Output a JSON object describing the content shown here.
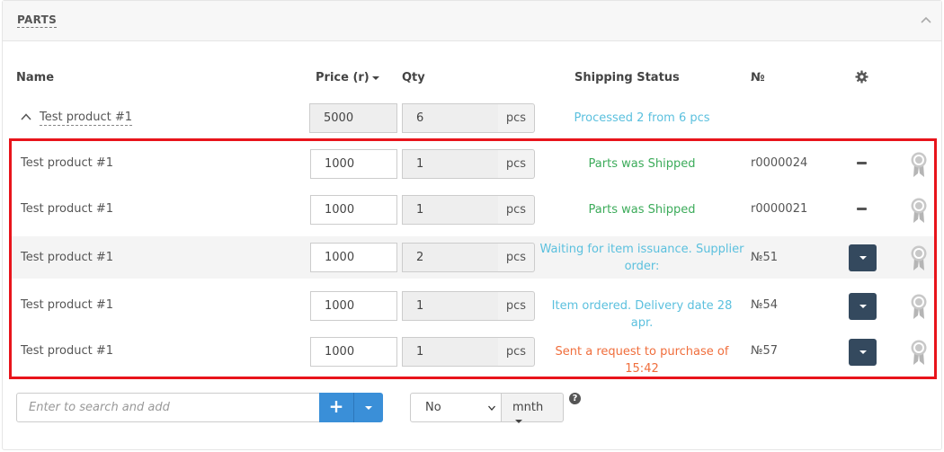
{
  "panel": {
    "title": "PARTS"
  },
  "columns": {
    "name": "Name",
    "price": "Price (r)",
    "qty": "Qty",
    "shipping_status": "Shipping Status",
    "number": "№"
  },
  "main_product": {
    "name": "Test product #1",
    "price": "5000",
    "qty": "6",
    "unit": "pcs",
    "status": "Processed 2 from 6 pcs"
  },
  "rows": [
    {
      "name": "Test product #1",
      "price": "1000",
      "qty": "1",
      "unit": "pcs",
      "status": "Parts was Shipped",
      "number": "r0000024",
      "action": "minus"
    },
    {
      "name": "Test product #1",
      "price": "1000",
      "qty": "1",
      "unit": "pcs",
      "status": "Parts was Shipped",
      "number": "r0000021",
      "action": "minus"
    },
    {
      "name": "Test product #1",
      "price": "1000",
      "qty": "2",
      "unit": "pcs",
      "status": "Waiting for item issuance. Supplier order:",
      "number": "№51",
      "action": "dropdown"
    },
    {
      "name": "Test product #1",
      "price": "1000",
      "qty": "1",
      "unit": "pcs",
      "status": "Item ordered. Delivery date 28 apr.",
      "number": "№54",
      "action": "dropdown"
    },
    {
      "name": "Test product #1",
      "price": "1000",
      "qty": "1",
      "unit": "pcs",
      "status": "Sent a request to purchase of 15:42",
      "number": "№57",
      "action": "dropdown"
    }
  ],
  "footer": {
    "search_placeholder": "Enter to search and add",
    "add_label": "+",
    "period_value": "No",
    "period_unit": "mnth",
    "help": "?"
  },
  "colors": {
    "status_teal": "#5bc0de",
    "status_green": "#3cab5a",
    "status_orange": "#f06e3c",
    "highlight_border": "#e8141b",
    "primary": "#3a8fd8",
    "dark_button": "#34495e"
  },
  "icons": [
    "chevron-up-icon",
    "caret-down-icon",
    "gear-icon",
    "chevron-up-icon",
    "minus-icon",
    "award-icon",
    "plus-icon",
    "help-icon"
  ]
}
